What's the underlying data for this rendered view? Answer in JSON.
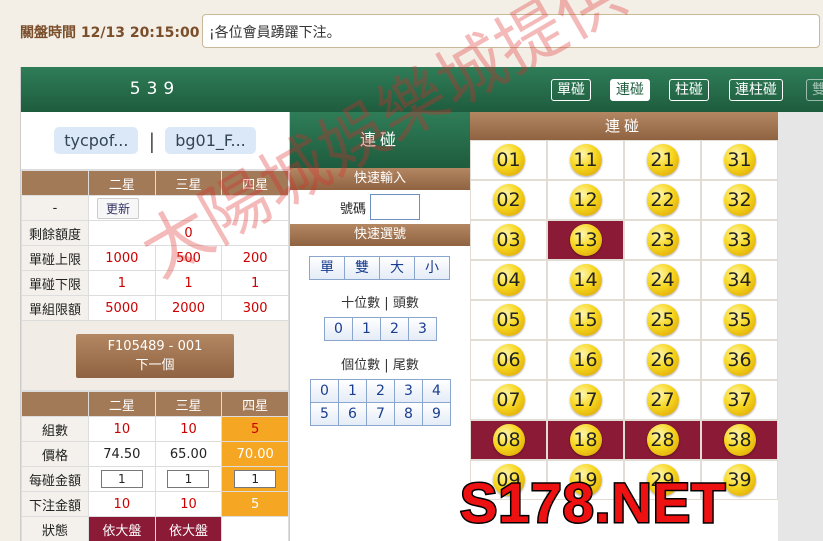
{
  "topbar": {
    "close_time": "關盤時間 12/13 20:15:00",
    "marquee": "¡各位會員踴躍下注。"
  },
  "game": {
    "title": "539"
  },
  "accounts": {
    "a": "tycpof...",
    "sep": "|",
    "b": "bg01_F..."
  },
  "limits": {
    "headers": [
      "",
      "二星",
      "三星",
      "四星"
    ],
    "update_label": "更新",
    "dash": "-",
    "rows": [
      {
        "label": "剩餘額度",
        "value": "0"
      },
      {
        "label": "單碰上限",
        "values": [
          "1000",
          "500",
          "200"
        ]
      },
      {
        "label": "單碰下限",
        "values": [
          "1",
          "1",
          "1"
        ]
      },
      {
        "label": "單組限額",
        "values": [
          "5000",
          "2000",
          "300"
        ]
      }
    ]
  },
  "next": {
    "code": "F105489 - 001",
    "label": "下一個"
  },
  "bets": {
    "headers": [
      "",
      "二星",
      "三星",
      "四星"
    ],
    "count_label": "組數",
    "counts": [
      "10",
      "10",
      "5"
    ],
    "price_label": "價格",
    "prices": [
      "74.50",
      "65.00",
      "70.00"
    ],
    "amount_label": "每碰金額",
    "amounts": [
      "1",
      "1",
      "1"
    ],
    "total_label": "下注金額",
    "totals": [
      "10",
      "10",
      "5"
    ],
    "status_label": "狀態",
    "statuses": [
      "依大盤",
      "依大盤"
    ]
  },
  "modes": [
    "單碰",
    "連碰",
    "柱碰",
    "連柱碰",
    "雙"
  ],
  "mid": {
    "title": "連碰",
    "quick_input": "快速輸入",
    "number_label": "號碼",
    "quick_pick": "快速選號",
    "quick_btns": [
      "單",
      "雙",
      "大",
      "小"
    ],
    "tens_label": "十位數 | 頭數",
    "tens": [
      "0",
      "1",
      "2",
      "3"
    ],
    "units_label": "個位數 | 尾數",
    "units": [
      "0",
      "1",
      "2",
      "3",
      "4",
      "5",
      "6",
      "7",
      "8",
      "9"
    ]
  },
  "balls": {
    "title": "連碰",
    "numbers": [
      "01",
      "11",
      "21",
      "31",
      "02",
      "12",
      "22",
      "32",
      "03",
      "13",
      "23",
      "33",
      "04",
      "14",
      "24",
      "34",
      "05",
      "15",
      "25",
      "35",
      "06",
      "16",
      "26",
      "36",
      "07",
      "17",
      "27",
      "37",
      "08",
      "18",
      "28",
      "38",
      "09",
      "19",
      "29",
      "39"
    ],
    "selected": [
      "13",
      "08",
      "18",
      "28",
      "38"
    ]
  },
  "watermark": {
    "text": "太陽城娛樂城提供",
    "logo": "S178.NET"
  },
  "colors": {
    "green": "#1e5c3e",
    "brown": "#8f6341",
    "maroon": "#8b1a37",
    "orange": "#f5a623",
    "ball": "#f7d71e"
  }
}
